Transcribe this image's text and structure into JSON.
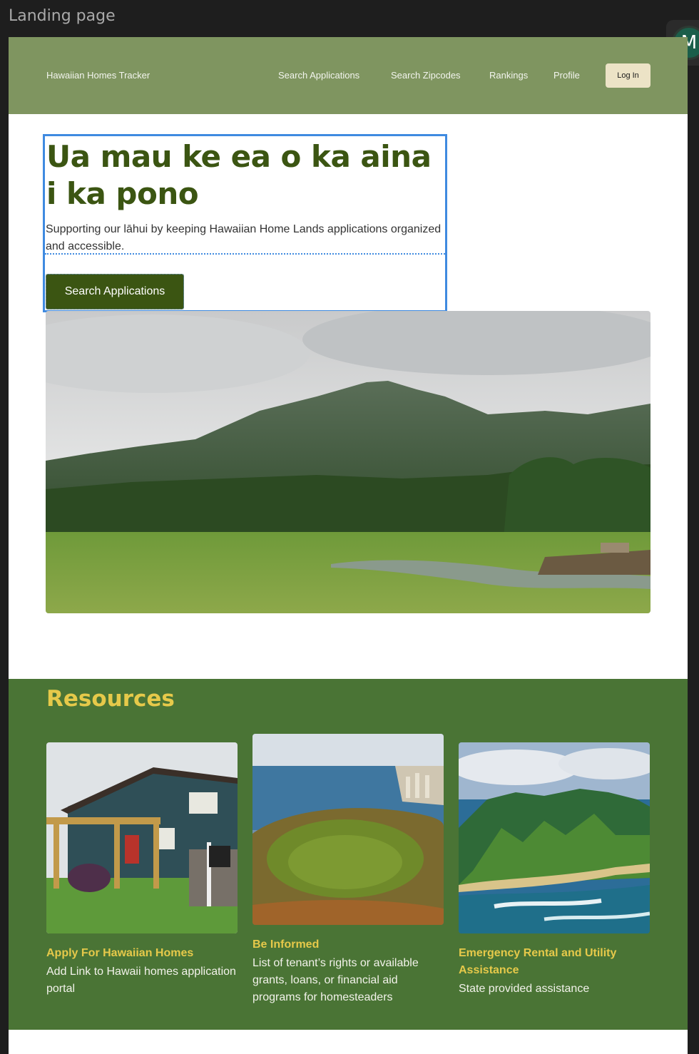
{
  "frame_label": "Landing page",
  "avatar": {
    "initial": "M",
    "color": "#1b5e4a"
  },
  "nav": {
    "brand": "Hawaiian Homes Tracker",
    "links": [
      "Search Applications",
      "Search Zipcodes",
      "Rankings",
      "Profile"
    ],
    "login_label": "Log In",
    "background": "#7f9560"
  },
  "hero": {
    "title": "Ua mau ke ea o ka aina i ka pono",
    "subtitle": "Supporting our lāhui by keeping Hawaiian Home Lands applications organized and accessible.",
    "cta_label": "Search Applications",
    "image": "mountain-landscape"
  },
  "resources": {
    "title": "Resources",
    "background": "#4a7435",
    "cards": [
      {
        "image": "house-for-sale",
        "title": "Apply For Hawaiian Homes",
        "description": "Add Link to Hawaii homes application portal"
      },
      {
        "image": "diamond-head-crater",
        "title": "Be Informed",
        "description": "List of tenant’s rights or available grants, loans, or financial aid programs for homesteaders"
      },
      {
        "image": "coastal-cliffs",
        "title": "Emergency Rental and Utility Assistance",
        "description": "State provided assistance"
      }
    ]
  }
}
